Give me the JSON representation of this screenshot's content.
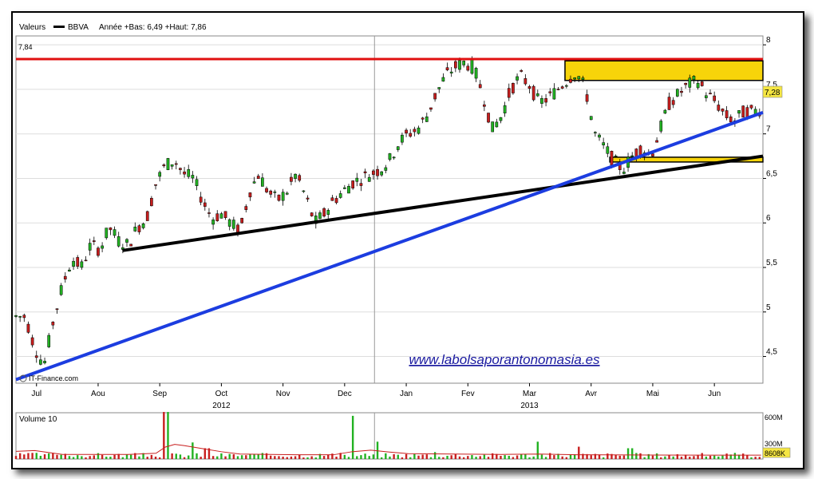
{
  "header": {
    "valeurs_label": "Valeurs",
    "ticker": "BBVA",
    "summary": "Année +Bas: 6,49 +Haut: 7,86"
  },
  "logo_text": "IT-Finance.com",
  "watermark": "www.labolsaporantonomasia.es",
  "resistance_label": "7,84",
  "last_price_label": "7,28",
  "volume_panel": {
    "title": "Volume 10",
    "axis_labels": [
      "600M",
      "300M"
    ],
    "last_volume": "8608K"
  },
  "chart_data": {
    "type": "candlestick",
    "ylim": [
      4.2,
      8.1
    ],
    "y_ticks": [
      8,
      7.5,
      7,
      6.5,
      6,
      5.5,
      5,
      4.5
    ],
    "y_tick_labels": [
      "8",
      "7,5",
      "7",
      "6,5",
      "6",
      "5,5",
      "5",
      "4,5"
    ],
    "x_month_labels": [
      "Jul",
      "Aou",
      "Sep",
      "Oct",
      "Nov",
      "Dec",
      "Jan",
      "Fev",
      "Mar",
      "Avr",
      "Mai",
      "Jun"
    ],
    "year_labels": [
      "2012",
      "2013"
    ],
    "price_path": [
      [
        0,
        4.95
      ],
      [
        5,
        4.95
      ],
      [
        10,
        4.6
      ],
      [
        15,
        4.4
      ],
      [
        20,
        4.9
      ],
      [
        25,
        5.3
      ],
      [
        30,
        5.6
      ],
      [
        35,
        5.5
      ],
      [
        40,
        5.75
      ],
      [
        45,
        5.7
      ],
      [
        50,
        5.95
      ],
      [
        55,
        5.8
      ],
      [
        60,
        5.75
      ],
      [
        65,
        5.95
      ],
      [
        70,
        6.05
      ],
      [
        75,
        6.45
      ],
      [
        80,
        6.65
      ],
      [
        85,
        6.7
      ],
      [
        90,
        6.55
      ],
      [
        95,
        6.5
      ],
      [
        100,
        6.25
      ],
      [
        105,
        6.05
      ],
      [
        110,
        6.1
      ],
      [
        115,
        6.0
      ],
      [
        120,
        5.9
      ],
      [
        125,
        6.35
      ],
      [
        130,
        6.55
      ],
      [
        135,
        6.35
      ],
      [
        140,
        6.25
      ],
      [
        145,
        6.35
      ],
      [
        150,
        6.55
      ],
      [
        155,
        6.3
      ],
      [
        160,
        6.0
      ],
      [
        165,
        6.1
      ],
      [
        170,
        6.25
      ],
      [
        175,
        6.35
      ],
      [
        180,
        6.45
      ],
      [
        185,
        6.5
      ],
      [
        190,
        6.55
      ],
      [
        195,
        6.6
      ],
      [
        200,
        6.7
      ],
      [
        205,
        6.9
      ],
      [
        210,
        7.0
      ],
      [
        215,
        7.05
      ],
      [
        220,
        7.2
      ],
      [
        225,
        7.45
      ],
      [
        230,
        7.65
      ],
      [
        235,
        7.75
      ],
      [
        240,
        7.8
      ],
      [
        245,
        7.75
      ],
      [
        250,
        7.45
      ],
      [
        255,
        7.05
      ],
      [
        260,
        7.2
      ],
      [
        265,
        7.5
      ],
      [
        270,
        7.65
      ],
      [
        275,
        7.55
      ],
      [
        280,
        7.35
      ],
      [
        285,
        7.4
      ],
      [
        290,
        7.5
      ],
      [
        295,
        7.6
      ],
      [
        300,
        7.7
      ],
      [
        305,
        7.5
      ],
      [
        310,
        7.0
      ],
      [
        315,
        6.85
      ],
      [
        320,
        6.7
      ],
      [
        325,
        6.6
      ],
      [
        330,
        6.75
      ],
      [
        335,
        6.85
      ],
      [
        340,
        6.75
      ],
      [
        345,
        7.05
      ],
      [
        350,
        7.35
      ],
      [
        355,
        7.45
      ],
      [
        360,
        7.55
      ],
      [
        365,
        7.6
      ],
      [
        370,
        7.45
      ],
      [
        375,
        7.35
      ],
      [
        380,
        7.2
      ],
      [
        385,
        7.15
      ],
      [
        390,
        7.25
      ],
      [
        395,
        7.25
      ],
      [
        399,
        7.28
      ]
    ],
    "annotations": {
      "resistance_level": 7.84,
      "resistance_zone": [
        7.6,
        7.82
      ],
      "support_zone": [
        6.68,
        6.72
      ],
      "black_trendline": [
        [
          57,
          5.69
        ],
        [
          400,
          6.75
        ]
      ],
      "blue_trendline": [
        [
          0,
          4.24
        ],
        [
          400,
          7.24
        ]
      ]
    },
    "volume": {
      "ylim": [
        0,
        600
      ],
      "bars": [
        [
          10,
          80
        ],
        [
          23,
          55
        ],
        [
          80,
          610
        ],
        [
          95,
          215
        ],
        [
          102,
          140
        ],
        [
          180,
          560
        ],
        [
          193,
          225
        ],
        [
          225,
          90
        ],
        [
          280,
          225
        ],
        [
          301,
          160
        ],
        [
          329,
          140
        ]
      ],
      "moving_average": [
        [
          0,
          100
        ],
        [
          10,
          110
        ],
        [
          25,
          60
        ],
        [
          60,
          60
        ],
        [
          75,
          75
        ],
        [
          80,
          155
        ],
        [
          85,
          190
        ],
        [
          90,
          175
        ],
        [
          100,
          135
        ],
        [
          110,
          95
        ],
        [
          120,
          65
        ],
        [
          150,
          55
        ],
        [
          170,
          55
        ],
        [
          180,
          95
        ],
        [
          190,
          115
        ],
        [
          200,
          90
        ],
        [
          210,
          70
        ],
        [
          260,
          60
        ],
        [
          280,
          65
        ],
        [
          300,
          55
        ],
        [
          340,
          52
        ],
        [
          399,
          50
        ]
      ]
    },
    "series": [
      {
        "name": "BBVA",
        "color": "#000000"
      }
    ]
  }
}
